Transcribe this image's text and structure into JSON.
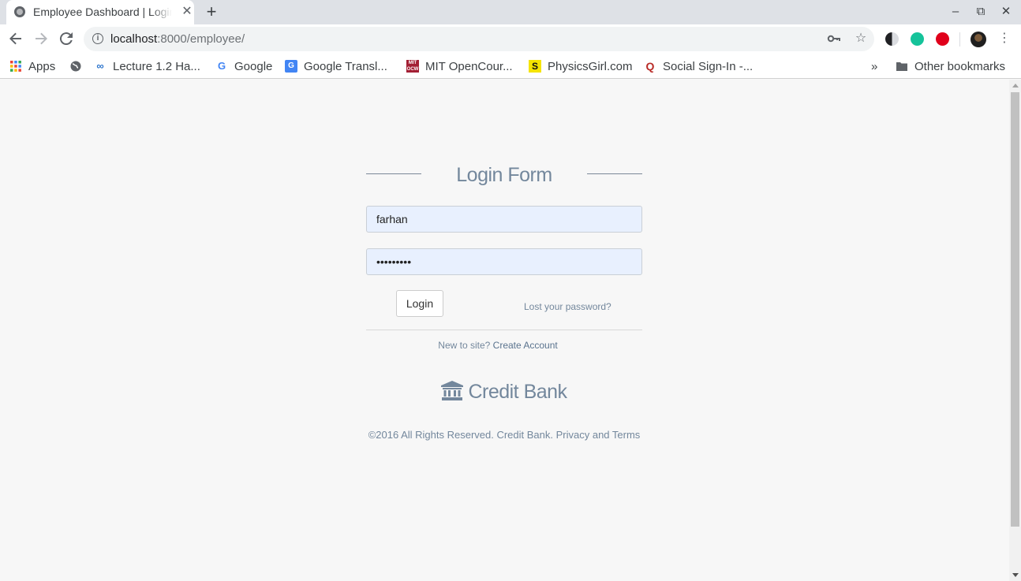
{
  "browser": {
    "tab_title": "Employee Dashboard | Login",
    "tab_close": "✕",
    "new_tab": "+",
    "url_host": "localhost",
    "url_rest": ":8000/employee/",
    "window_controls": {
      "minimize": "–",
      "maximize": "⧉",
      "close": "✕"
    },
    "extension_colors": [
      "#202124",
      "#15c39a",
      "#e0001b",
      "#1f1f1f"
    ]
  },
  "bookmarks": {
    "items": [
      {
        "label": "Apps",
        "icon": "apps-grid-icon"
      },
      {
        "label": "",
        "icon": "globe-icon"
      },
      {
        "label": "Lecture 1.2 Ha...",
        "icon": "coursera-icon"
      },
      {
        "label": "Google",
        "icon": "google-icon"
      },
      {
        "label": "Google Transl...",
        "icon": "google-translate-icon"
      },
      {
        "label": "MIT OpenCour...",
        "icon": "mit-ocw-icon"
      },
      {
        "label": "PhysicsGirl.com",
        "icon": "physicsgirl-icon"
      },
      {
        "label": "Social Sign-In -...",
        "icon": "quora-icon"
      }
    ],
    "overflow": "»",
    "other": "Other bookmarks"
  },
  "login": {
    "title": "Login Form",
    "username_value": "farhan",
    "password_value": "•••••••••",
    "login_button": "Login",
    "lost_password": "Lost your password?",
    "new_to_site": "New to site?",
    "create_account": "Create Account",
    "brand": "Credit Bank",
    "footer": "©2016 All Rights Reserved. Credit Bank. Privacy and Terms"
  },
  "colors": {
    "text_muted": "#73879c",
    "input_autofill": "#e8f0fe",
    "page_bg": "#f7f7f7"
  }
}
